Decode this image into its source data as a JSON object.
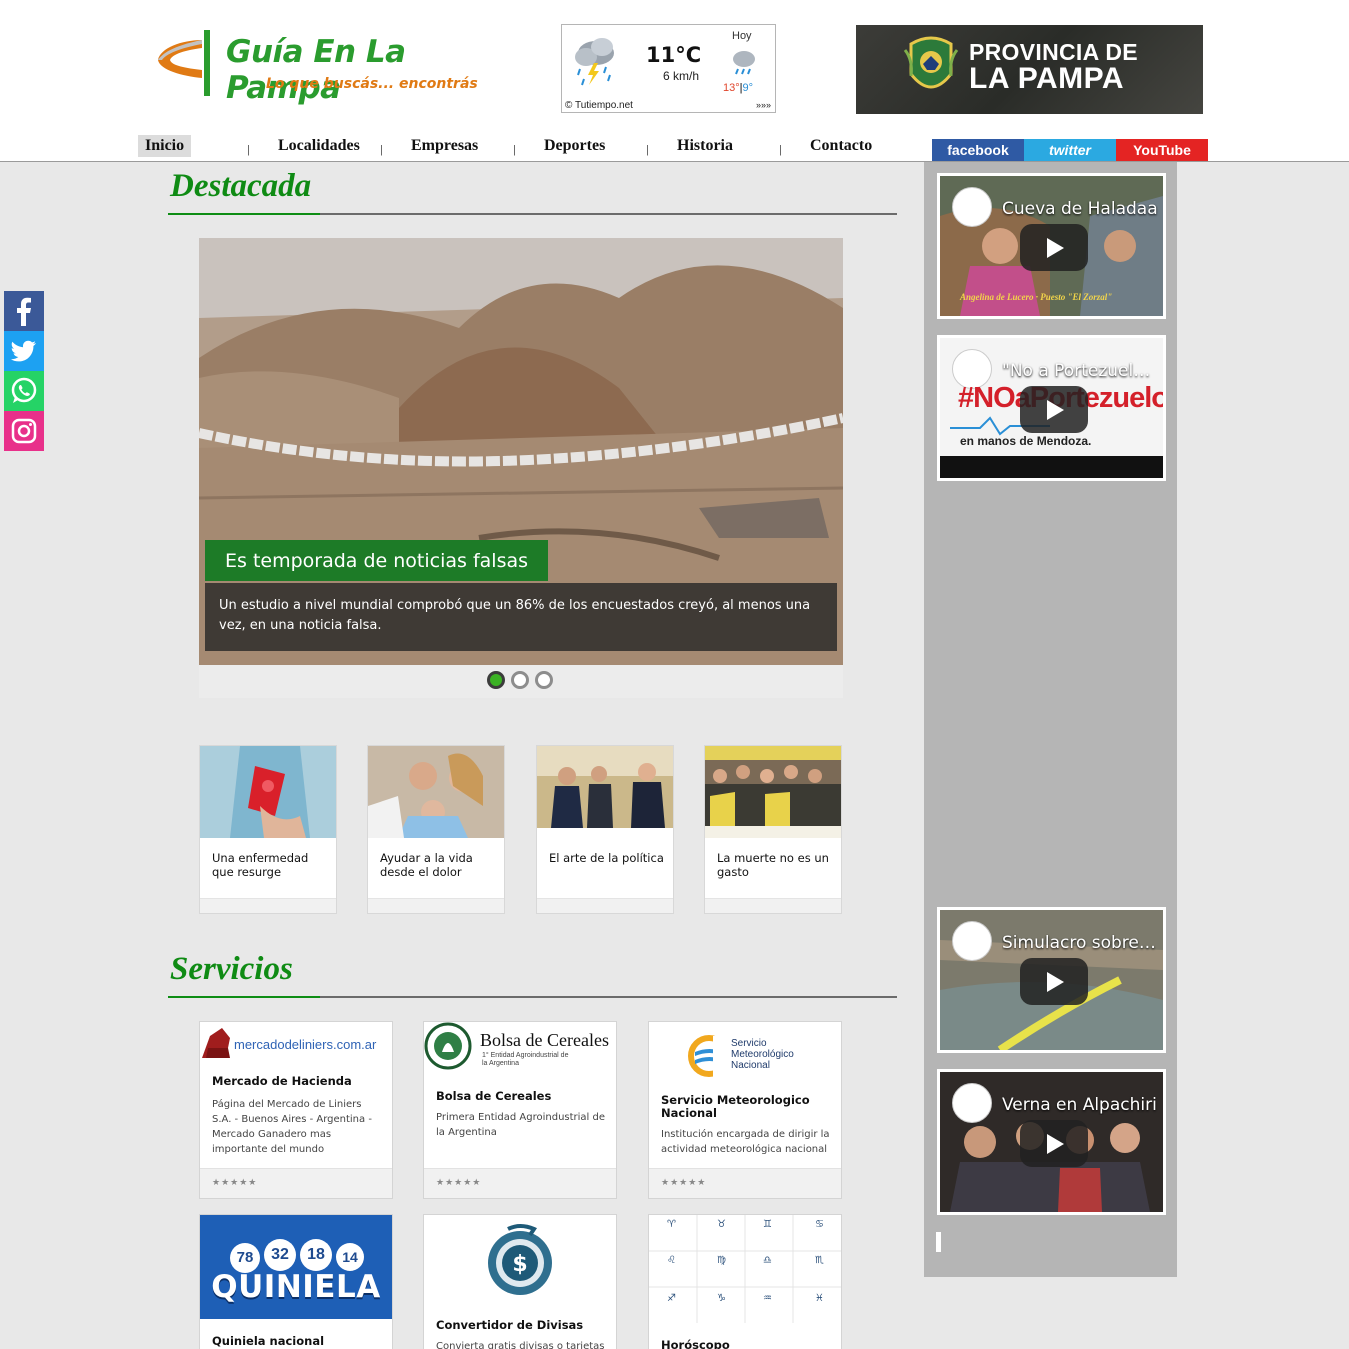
{
  "header": {
    "brand": "Guía En La Pampa",
    "tagline": "Lo que buscás... encontrás",
    "weather": {
      "temp": "11°C",
      "wind": "6 km/h",
      "day_label": "Hoy",
      "high": "13°",
      "sep": "|",
      "low": "9°",
      "source": "© Tutiempo.net",
      "more": "»»»"
    },
    "banner": {
      "line1": "PROVINCIA DE",
      "line2": "LA PAMPA"
    }
  },
  "nav": {
    "items": [
      "Inicio",
      "Localidades",
      "Empresas",
      "Deportes",
      "Historia",
      "Contacto"
    ],
    "separator": "|"
  },
  "social_top": {
    "facebook": "facebook",
    "twitter": "twitter",
    "youtube": "YouTube"
  },
  "share_bar": [
    "facebook-icon",
    "twitter-icon",
    "whatsapp-icon",
    "instagram-icon"
  ],
  "destacada": {
    "title": "Destacada",
    "slide": {
      "title": "Es temporada de noticias falsas",
      "description": "Un estudio a nivel mundial comprobó que un 86% de los encuestados creyó, al menos una vez, en una noticia falsa."
    },
    "slides_count": 3,
    "active_slide": 1,
    "cards": [
      "Una enfermedad que resurge",
      "Ayudar a la vida desde el dolor",
      "El arte de la política",
      "La muerte no es un gasto"
    ]
  },
  "servicios": {
    "title": "Servicios",
    "items": [
      {
        "logo": "mercadodeliniers.com.ar",
        "title": "Mercado de Hacienda",
        "desc": "Página del Mercado de Liniers S.A. - Buenos Aires - Argentina - Mercado Ganadero mas importante del mundo",
        "rating": "★★★★★"
      },
      {
        "logo": "Bolsa de Cereales",
        "logo_sub": "1° Entidad Agroindustrial de la Argentina",
        "title": "Bolsa de Cereales",
        "desc": "Primera Entidad Agroindustrial de la Argentina",
        "rating": "★★★★★"
      },
      {
        "logo": "Servicio Meteorológico Nacional",
        "title": "Servicio Meteorologico Nacional",
        "desc": "Institución encargada de dirigir la actividad meteorológica nacional",
        "rating": "★★★★★"
      },
      {
        "logo": "QUINIELA",
        "balls": [
          "78",
          "32",
          "18",
          "14"
        ],
        "title": "Quiniela nacional"
      },
      {
        "title": "Convertidor de Divisas",
        "desc": "Convierta gratis divisas o tarjetas"
      },
      {
        "title": "Horóscopo"
      }
    ]
  },
  "videos": [
    {
      "title": "Cueva de Haladaa",
      "caption": "Angelina de Lucero · Puesto \"El Zorzal\""
    },
    {
      "title": "\"No a Portezuelo del Viento\"",
      "overlay": "#NOaPortezuelo",
      "overlay_sub": "en manos de Mendoza."
    },
    {
      "title": "Simulacro sobre el río"
    },
    {
      "title": "Verna en Alpachiri"
    }
  ],
  "colors": {
    "brand_green": "#2a9c2e",
    "accent_orange": "#e07a14",
    "section_green": "#0f8b14"
  }
}
